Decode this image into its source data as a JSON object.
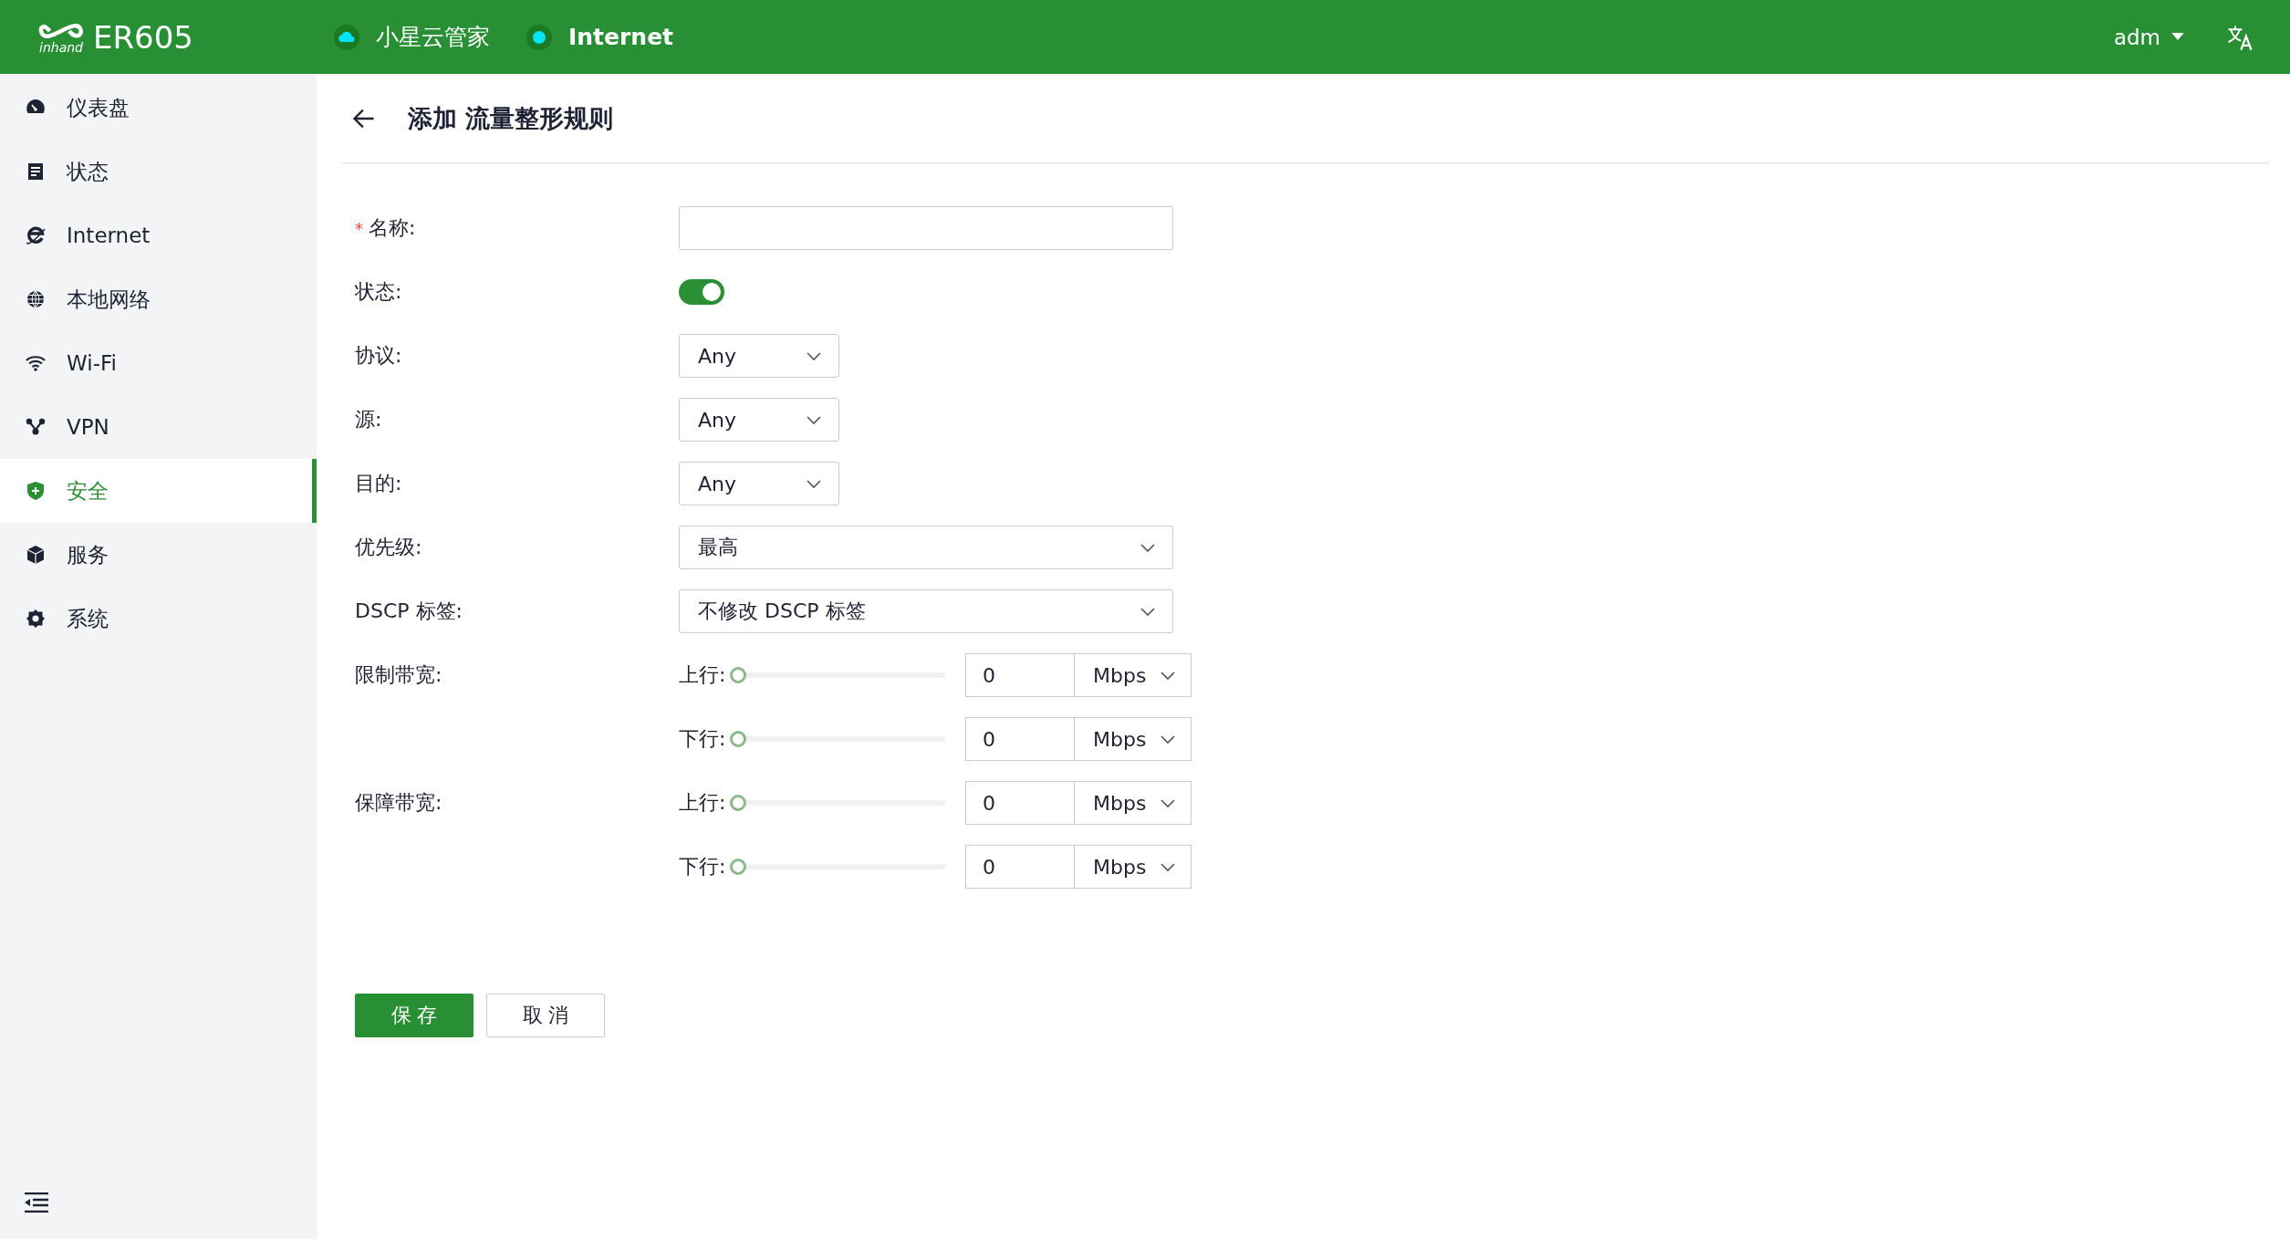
{
  "header": {
    "logo_text": "inhand",
    "model": "ER605",
    "status_items": [
      {
        "kind": "cloud",
        "label": "小星云管家",
        "online": true
      },
      {
        "kind": "dot",
        "label": "Internet",
        "online": true
      }
    ],
    "user": "adm"
  },
  "sidebar": {
    "items": [
      {
        "label": "仪表盘",
        "selected": false
      },
      {
        "label": "状态",
        "selected": false
      },
      {
        "label": "Internet",
        "selected": false
      },
      {
        "label": "本地网络",
        "selected": false
      },
      {
        "label": "Wi-Fi",
        "selected": false
      },
      {
        "label": "VPN",
        "selected": false
      },
      {
        "label": "安全",
        "selected": true
      },
      {
        "label": "服务",
        "selected": false
      },
      {
        "label": "系统",
        "selected": false
      }
    ]
  },
  "page": {
    "title": "添加 流量整形规则"
  },
  "form": {
    "rows": [
      {
        "kind": "text",
        "label": "名称:",
        "required_mark": "*"
      },
      {
        "kind": "switch",
        "label": "状态:",
        "on": true
      },
      {
        "kind": "select",
        "label": "协议:",
        "value": "Any",
        "wide": false
      },
      {
        "kind": "select",
        "label": "源:",
        "value": "Any",
        "wide": false
      },
      {
        "kind": "select",
        "label": "目的:",
        "value": "Any",
        "wide": false
      },
      {
        "kind": "select",
        "label": "优先级:",
        "value": "最高",
        "wide": true
      },
      {
        "kind": "select",
        "label": "DSCP 标签:",
        "value": "不修改 DSCP 标签",
        "wide": true
      },
      {
        "kind": "bandwidth",
        "label": "限制带宽:",
        "lines": [
          {
            "direction": "上行:",
            "level": 0,
            "value": "0",
            "unit": "Mbps"
          },
          {
            "direction": "下行:",
            "level": 0,
            "value": "0",
            "unit": "Mbps"
          }
        ]
      },
      {
        "kind": "bandwidth",
        "label": "保障带宽:",
        "lines": [
          {
            "direction": "上行:",
            "level": 0,
            "value": "0",
            "unit": "Mbps"
          },
          {
            "direction": "下行:",
            "level": 0,
            "value": "0",
            "unit": "Mbps"
          }
        ]
      }
    ],
    "buttons": [
      {
        "kind": "primary",
        "label": "保 存"
      },
      {
        "kind": "default",
        "label": "取 消"
      }
    ]
  }
}
